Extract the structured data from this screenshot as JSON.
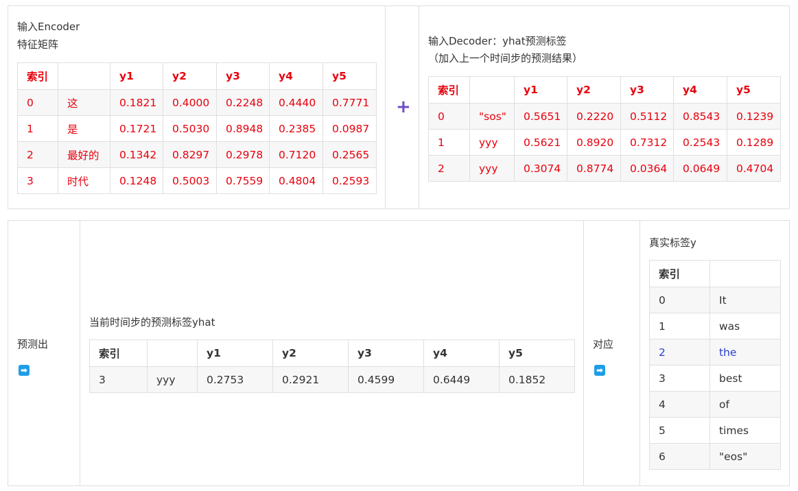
{
  "top": {
    "encoder_caption_line1": "输入Encoder",
    "encoder_caption_line2": "特征矩阵",
    "plus_symbol": "+",
    "decoder_caption_line1": "输入Decoder：yhat预测标签",
    "decoder_caption_line2": "（加入上一个时间步的预测结果）",
    "encoder_table": {
      "headers": [
        "索引",
        "",
        "y1",
        "y2",
        "y3",
        "y4",
        "y5"
      ],
      "rows": [
        [
          "0",
          "这",
          "0.1821",
          "0.4000",
          "0.2248",
          "0.4440",
          "0.7771"
        ],
        [
          "1",
          "是",
          "0.1721",
          "0.5030",
          "0.8948",
          "0.2385",
          "0.0987"
        ],
        [
          "2",
          "最好的",
          "0.1342",
          "0.8297",
          "0.2978",
          "0.7120",
          "0.2565"
        ],
        [
          "3",
          "时代",
          "0.1248",
          "0.5003",
          "0.7559",
          "0.4804",
          "0.2593"
        ]
      ]
    },
    "decoder_table": {
      "headers": [
        "索引",
        "",
        "y1",
        "y2",
        "y3",
        "y4",
        "y5"
      ],
      "rows": [
        [
          "0",
          "\"sos\"",
          "0.5651",
          "0.2220",
          "0.5112",
          "0.8543",
          "0.1239"
        ],
        [
          "1",
          "yyy",
          "0.5621",
          "0.8920",
          "0.7312",
          "0.2543",
          "0.1289"
        ],
        [
          "2",
          "yyy",
          "0.3074",
          "0.8774",
          "0.0364",
          "0.0649",
          "0.4704"
        ]
      ]
    }
  },
  "bottom": {
    "predict_label": "预测出",
    "current_caption": "当前时间步的预测标签yhat",
    "current_table": {
      "headers": [
        "索引",
        "",
        "y1",
        "y2",
        "y3",
        "y4",
        "y5"
      ],
      "rows": [
        [
          "3",
          "yyy",
          "0.2753",
          "0.2921",
          "0.4599",
          "0.6449",
          "0.1852"
        ]
      ]
    },
    "correspond_label": "对应",
    "truth_caption": "真实标签y",
    "truth_table": {
      "headers": [
        "索引",
        ""
      ],
      "rows": [
        [
          "0",
          "It"
        ],
        [
          "1",
          "was"
        ],
        [
          "2",
          "the"
        ],
        [
          "3",
          "best"
        ],
        [
          "4",
          "of"
        ],
        [
          "5",
          "times"
        ],
        [
          "6",
          "\"eos\""
        ]
      ]
    },
    "arrow_icon": "➡"
  },
  "colors": {
    "highlight_red": "#e8000d",
    "highlight_blue": "#2a3fd1",
    "plus_purple": "#6f4ec4",
    "arrow_blue": "#1e9de8",
    "border": "#dfdfdf"
  }
}
